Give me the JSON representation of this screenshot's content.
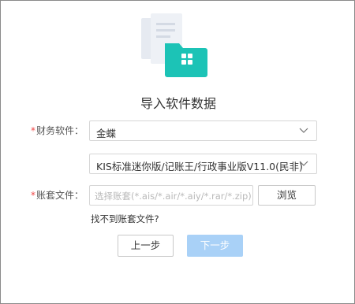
{
  "dialog": {
    "title": "导入软件数据"
  },
  "form": {
    "finance_software": {
      "label": "财务软件：",
      "value": "金蝶"
    },
    "version": {
      "value": "KIS标准迷你版/记账王/行政事业版V11.0(民非)"
    },
    "account_file": {
      "label": "账套文件：",
      "placeholder": "选择账套(*.ais/*.air/*.aiy/*.rar/*.zip)"
    },
    "required_mark": "*",
    "browse_label": "浏览",
    "help_link": "找不到账套文件?"
  },
  "actions": {
    "prev_label": "上一步",
    "next_label": "下一步"
  },
  "colors": {
    "accent_teal": "#1cc3b6",
    "primary_disabled": "#a9d1f7",
    "required_red": "#f04848"
  },
  "icons": {
    "hero": "folder-documents-icon",
    "dropdown": "chevron-down-icon"
  }
}
